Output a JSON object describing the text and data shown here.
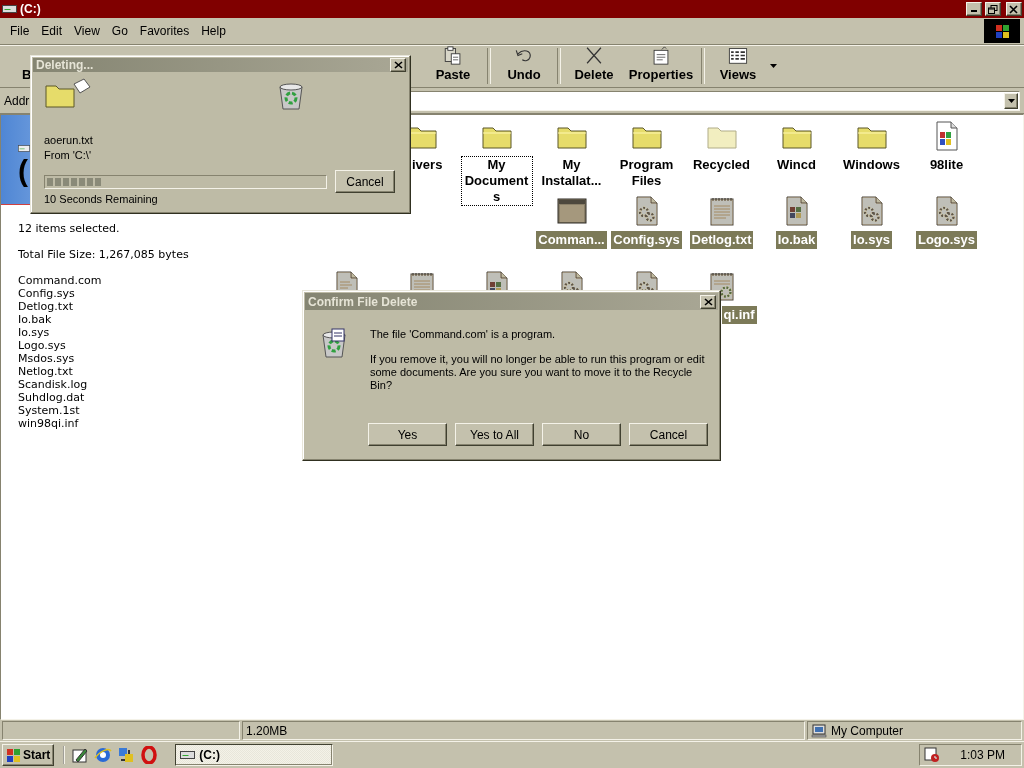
{
  "window": {
    "title": "(C:)"
  },
  "menu": [
    "File",
    "Edit",
    "View",
    "Go",
    "Favorites",
    "Help"
  ],
  "toolbar": [
    {
      "label": "B",
      "kind": "back"
    },
    {
      "label": "Paste",
      "kind": "paste"
    },
    {
      "label": "Undo",
      "kind": "undo"
    },
    {
      "label": "Delete",
      "kind": "delete"
    },
    {
      "label": "Properties",
      "kind": "properties"
    },
    {
      "label": "Views",
      "kind": "views"
    }
  ],
  "address": {
    "label": "Addr"
  },
  "web_panel": {
    "heading": "(",
    "summary": "12 items selected.",
    "size": "Total File Size: 1,267,085 bytes",
    "files": [
      "Command.com",
      "Config.sys",
      "Detlog.txt",
      "Io.bak",
      "Io.sys",
      "Logo.sys",
      "Msdos.sys",
      "Netlog.txt",
      "Scandisk.log",
      "Suhdlog.dat",
      "System.1st",
      "win98qi.inf"
    ]
  },
  "icon_rows": [
    {
      "items": [
        {
          "label": "ivers",
          "kind": "folder",
          "selected": false,
          "focused": false
        },
        {
          "label": "My Documents",
          "kind": "folder",
          "selected": false,
          "focused": true
        },
        {
          "label": "My Installat...",
          "kind": "folder",
          "selected": false,
          "focused": false
        },
        {
          "label": "Program Files",
          "kind": "folder",
          "selected": false,
          "focused": false
        },
        {
          "label": "Recycled",
          "kind": "hidden-folder",
          "selected": false,
          "focused": false
        },
        {
          "label": "Wincd",
          "kind": "folder",
          "selected": false,
          "focused": false
        },
        {
          "label": "Windows",
          "kind": "folder",
          "selected": false,
          "focused": false
        },
        {
          "label": "98lite",
          "kind": "application",
          "selected": false,
          "focused": false
        }
      ]
    },
    {
      "items": [
        {
          "label": "Comman...",
          "kind": "dos-program",
          "selected": true,
          "focused": false
        },
        {
          "label": "Config.sys",
          "kind": "system-file",
          "selected": true,
          "focused": false
        },
        {
          "label": "Detlog.txt",
          "kind": "text-file",
          "selected": true,
          "focused": false
        },
        {
          "label": "Io.bak",
          "kind": "backup-file",
          "selected": true,
          "focused": false
        },
        {
          "label": "Io.sys",
          "kind": "system-file",
          "selected": true,
          "focused": false
        },
        {
          "label": "Logo.sys",
          "kind": "system-file",
          "selected": true,
          "focused": false
        }
      ]
    },
    {
      "items": [
        {
          "kind": "document",
          "selected": true
        },
        {
          "kind": "text-file",
          "selected": true
        },
        {
          "kind": "backup-file",
          "selected": true
        },
        {
          "kind": "system-file",
          "selected": true
        },
        {
          "kind": "system-file",
          "selected": true
        },
        {
          "label": "qi.inf",
          "kind": "setup-info",
          "selected": true,
          "focused": false
        }
      ]
    }
  ],
  "status_bar": {
    "size": "1.20MB",
    "zone": "My Computer"
  },
  "deleting_dialog": {
    "title": "Deleting...",
    "file": "aoerun.txt",
    "from": "From 'C:\\'",
    "level": 0.2,
    "remaining": "10 Seconds Remaining",
    "button": "Cancel"
  },
  "confirm_dialog": {
    "title": "Confirm File Delete",
    "message": "The file 'Command.com' is a program.",
    "detail": "If you remove it, you will no longer be able to run this program or edit some documents. Are you sure you want to move it to the Recycle Bin?",
    "buttons": [
      "Yes",
      "Yes to All",
      "No",
      "Cancel"
    ]
  },
  "taskbar": {
    "start": "Start",
    "tasks": [
      {
        "label": "(C:)",
        "selected": true
      }
    ],
    "clock": "1:03 PM"
  }
}
